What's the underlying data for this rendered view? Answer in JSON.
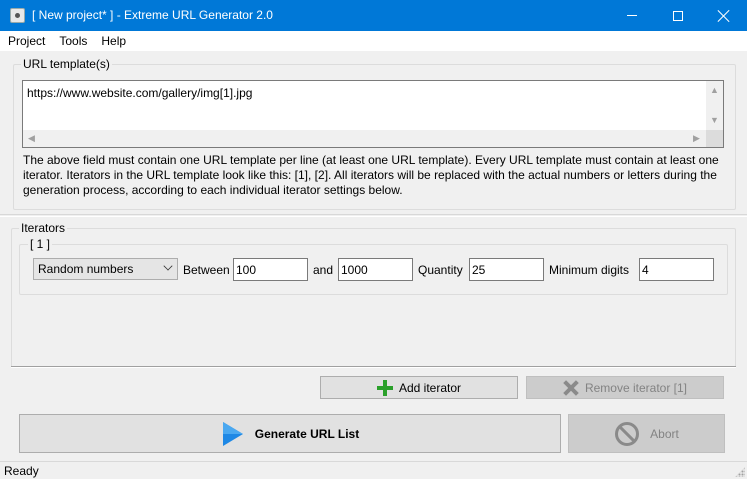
{
  "window": {
    "title": "[ New project* ] - Extreme URL Generator 2.0"
  },
  "menu": {
    "items": [
      "Project",
      "Tools",
      "Help"
    ]
  },
  "url_templates": {
    "group_label": "URL template(s)",
    "value": "https://www.website.com/gallery/img[1].jpg",
    "description": "The above field must contain one URL template per line (at least one URL template). Every URL template must contain at least one iterator. Iterators in the URL template look like this: [1], [2]. All iterators will be replaced with the actual numbers or letters during the generation process, according to each individual iterator settings below."
  },
  "iterators": {
    "group_label": "Iterators",
    "items": [
      {
        "label": "[ 1 ]",
        "type": "Random numbers",
        "between_label": "Between",
        "between_value": "100",
        "and_label": "and",
        "and_value": "1000",
        "quantity_label": "Quantity",
        "quantity_value": "25",
        "min_digits_label": "Minimum digits",
        "min_digits_value": "4"
      }
    ]
  },
  "buttons": {
    "add_iterator": "Add iterator",
    "remove_iterator": "Remove iterator [1]",
    "generate": "Generate URL List",
    "abort": "Abort"
  },
  "status": {
    "text": "Ready"
  },
  "icons": {
    "add": "plus-icon",
    "remove": "x-icon",
    "generate": "play-icon",
    "abort": "no-entry-icon"
  },
  "colors": {
    "titlebar": "#0078d7",
    "add_icon": "#2aa02a",
    "play_icon": "#1e88e5"
  }
}
